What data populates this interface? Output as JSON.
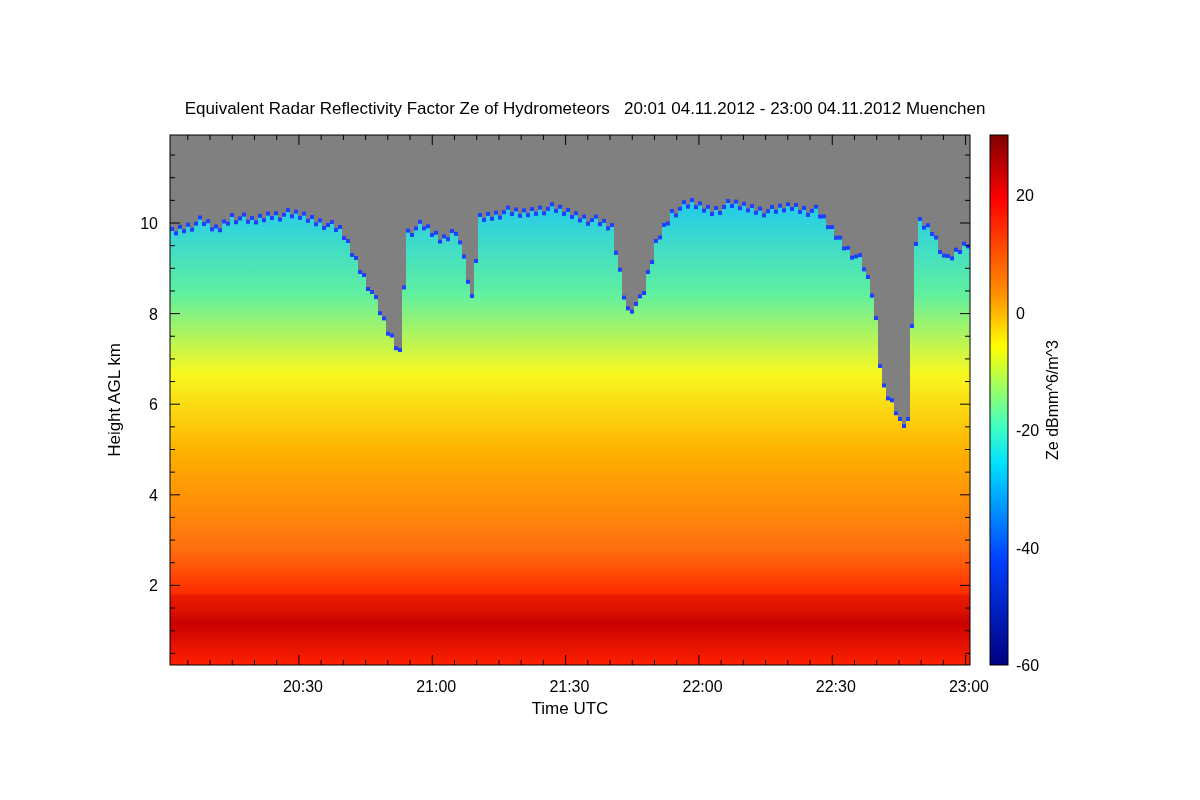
{
  "title": "Equivalent Radar Reflectivity Factor Ze of Hydrometeors   20:01 04.11.2012 - 23:00 04.11.2012 Muenchen",
  "y_axis": {
    "label": "Height AGL km",
    "ticks": [
      "10",
      "8",
      "6",
      "4",
      "2"
    ]
  },
  "x_axis": {
    "label": "Time UTC",
    "ticks": [
      "20:30",
      "21:00",
      "21:30",
      "22:00",
      "22:30",
      "23:00"
    ]
  },
  "colorbar": {
    "label": "Ze dBmm^6/m^3",
    "ticks": [
      "20",
      "0",
      "-20",
      "-40",
      "-60"
    ]
  }
}
